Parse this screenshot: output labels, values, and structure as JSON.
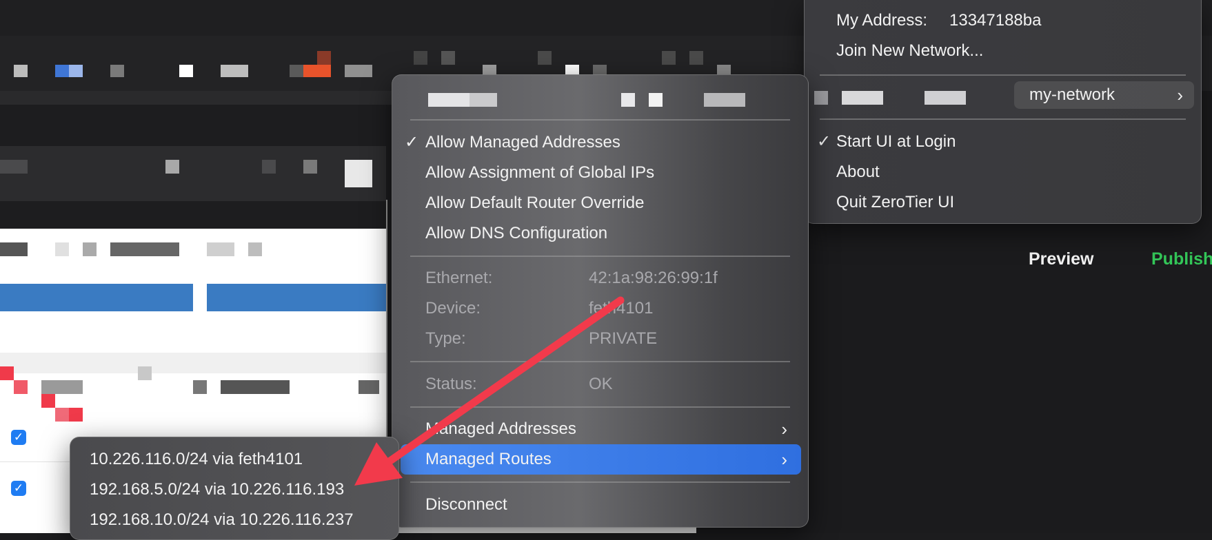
{
  "main_menu": {
    "my_address_label": "My Address:",
    "my_address_value": "13347188ba",
    "join_new_network": "Join New Network...",
    "network_name": "my-network",
    "start_ui_at_login": "Start UI at Login",
    "about": "About",
    "quit": "Quit ZeroTier UI"
  },
  "network_menu": {
    "allow_managed_addresses": "Allow Managed Addresses",
    "allow_global_ips": "Allow Assignment of Global IPs",
    "allow_default_router": "Allow Default Router Override",
    "allow_dns": "Allow DNS Configuration",
    "info": [
      {
        "label": "Ethernet:",
        "value": "42:1a:98:26:99:1f"
      },
      {
        "label": "Device:",
        "value": "feth4101"
      },
      {
        "label": "Type:",
        "value": "PRIVATE"
      }
    ],
    "status_label": "Status:",
    "status_value": "OK",
    "managed_addresses": "Managed Addresses",
    "managed_routes": "Managed Routes",
    "disconnect": "Disconnect"
  },
  "routes_menu": {
    "routes": [
      "10.226.116.0/24 via feth4101",
      "192.168.5.0/24 via 10.226.116.193",
      "192.168.10.0/24 via 10.226.116.237"
    ]
  },
  "background": {
    "preview": "Preview",
    "publish": "Publish"
  },
  "colors": {
    "highlight": "#3f80ea",
    "arrow": "#f23a4b",
    "publish": "#34c759"
  }
}
